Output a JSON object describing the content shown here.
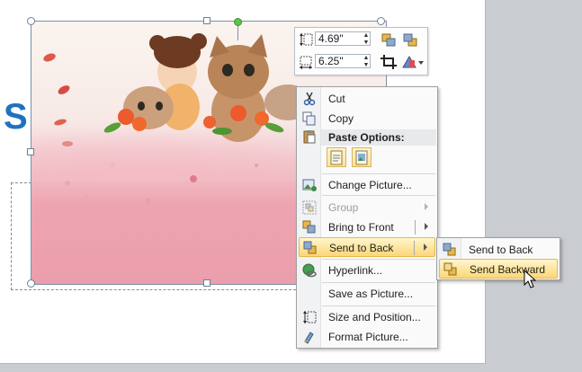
{
  "slide": {
    "title_fragment": "S"
  },
  "mini_toolbar": {
    "height_value": "4.69\"",
    "width_value": "6.25\""
  },
  "context_menu": {
    "items": {
      "cut": "Cut",
      "copy": "Copy",
      "paste_options": "Paste Options:",
      "change_picture": "Change Picture...",
      "group": "Group",
      "bring_to_front": "Bring to Front",
      "send_to_back": "Send to Back",
      "hyperlink": "Hyperlink...",
      "save_as_picture": "Save as Picture...",
      "size_and_position": "Size and Position...",
      "format_picture": "Format Picture..."
    }
  },
  "submenu": {
    "items": {
      "send_to_back": "Send to Back",
      "send_backward": "Send Backward"
    }
  },
  "colors": {
    "highlight": "#fde7a0",
    "title_blue": "#1e73c0",
    "rotate_handle": "#5fc24a"
  }
}
